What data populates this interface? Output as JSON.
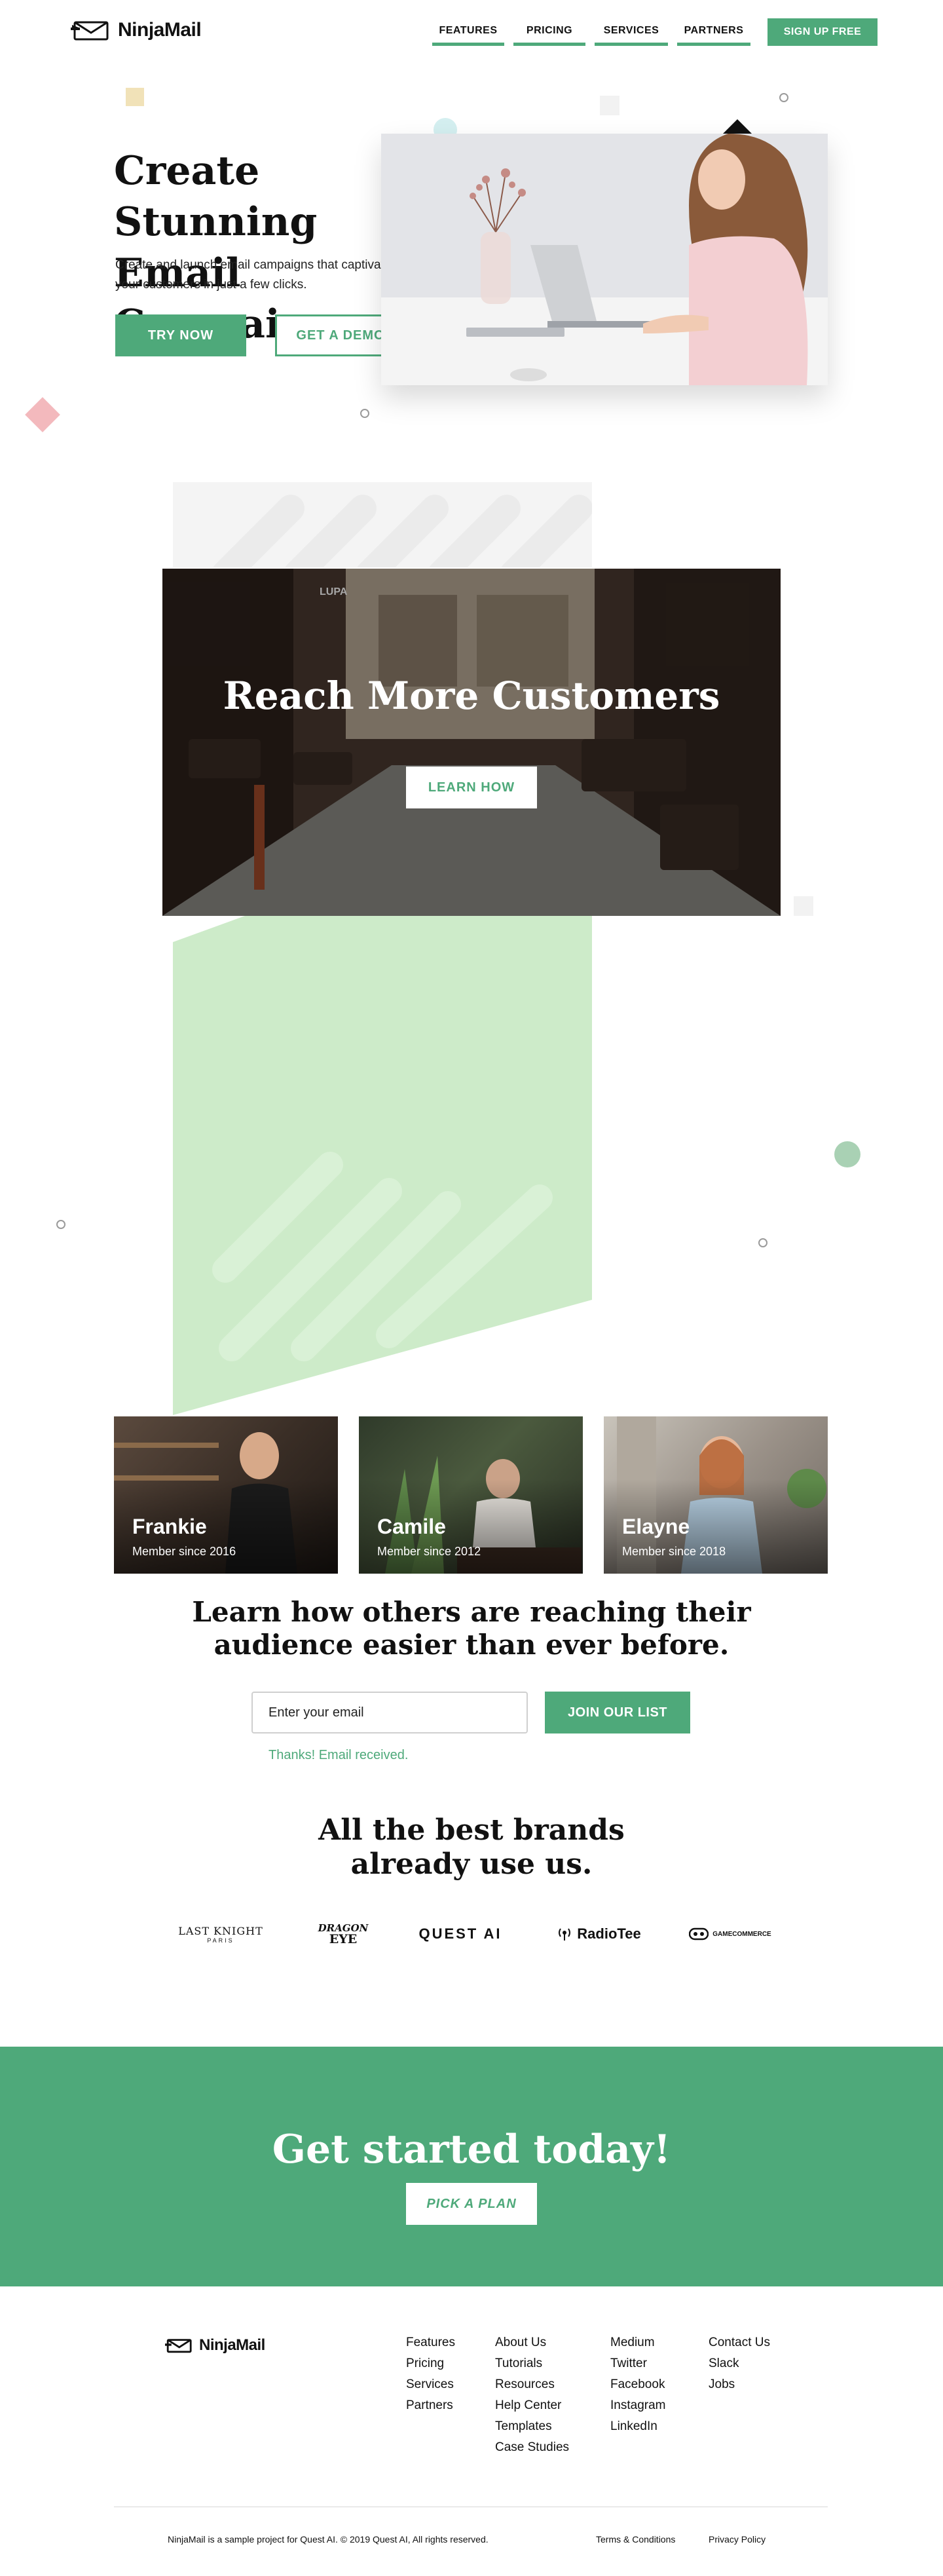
{
  "brand": {
    "name": "NinjaMail"
  },
  "nav": {
    "links": [
      "FEATURES",
      "PRICING",
      "SERVICES",
      "PARTNERS"
    ],
    "signup": "SIGN UP FREE"
  },
  "hero": {
    "title_line1": "Create Stunning",
    "title_line2": "Email Campaigns",
    "subtitle_line1": "Create and launch email campaigns that captivate",
    "subtitle_line2": "your customers in just a few clicks.",
    "try_now": "TRY NOW",
    "get_demo": "GET A DEMO"
  },
  "reach": {
    "title": "Reach More Customers",
    "button": "LEARN HOW",
    "sign_text": "LUPA"
  },
  "members": [
    {
      "name": "Frankie",
      "since": "Member since 2016"
    },
    {
      "name": "Camile",
      "since": "Member since 2012"
    },
    {
      "name": "Elayne",
      "since": "Member since 2018"
    }
  ],
  "subscribe": {
    "title_line1": "Learn how others are reaching their",
    "title_line2": "audience easier than ever before.",
    "placeholder": "Enter your email",
    "button": "JOIN OUR LIST",
    "thanks": "Thanks! Email received."
  },
  "brands": {
    "title_line1": "All the best brands",
    "title_line2": "already use us.",
    "logos": {
      "last_knight": "LAST KNIGHT",
      "last_knight_sub": "PARIS",
      "dragon_eye_1": "DRAGON",
      "dragon_eye_2": "EYE",
      "quest_ai": "QUEST AI",
      "radiotee": "RadioTee",
      "gamecommerce": "GAMECOMMERCE"
    }
  },
  "cta": {
    "title": "Get started today!",
    "button": "PICK A PLAN"
  },
  "footer": {
    "col1": [
      "Features",
      "Pricing",
      "Services",
      "Partners"
    ],
    "col2": [
      "About Us",
      "Tutorials",
      "Resources",
      "Help Center",
      "Templates",
      "Case Studies"
    ],
    "col3": [
      "Medium",
      "Twitter",
      "Facebook",
      "Instagram",
      "LinkedIn"
    ],
    "col4": [
      "Contact Us",
      "Slack",
      "Jobs"
    ],
    "copyright": "NinjaMail is a sample project for Quest AI. © 2019 Quest AI, All rights reserved.",
    "terms": "Terms & Conditions",
    "privacy": "Privacy Policy"
  },
  "colors": {
    "accent": "#4ea97a",
    "light_green": "#cdebc9",
    "dark": "#111111"
  },
  "icons": [
    "ninja-logo-icon"
  ]
}
